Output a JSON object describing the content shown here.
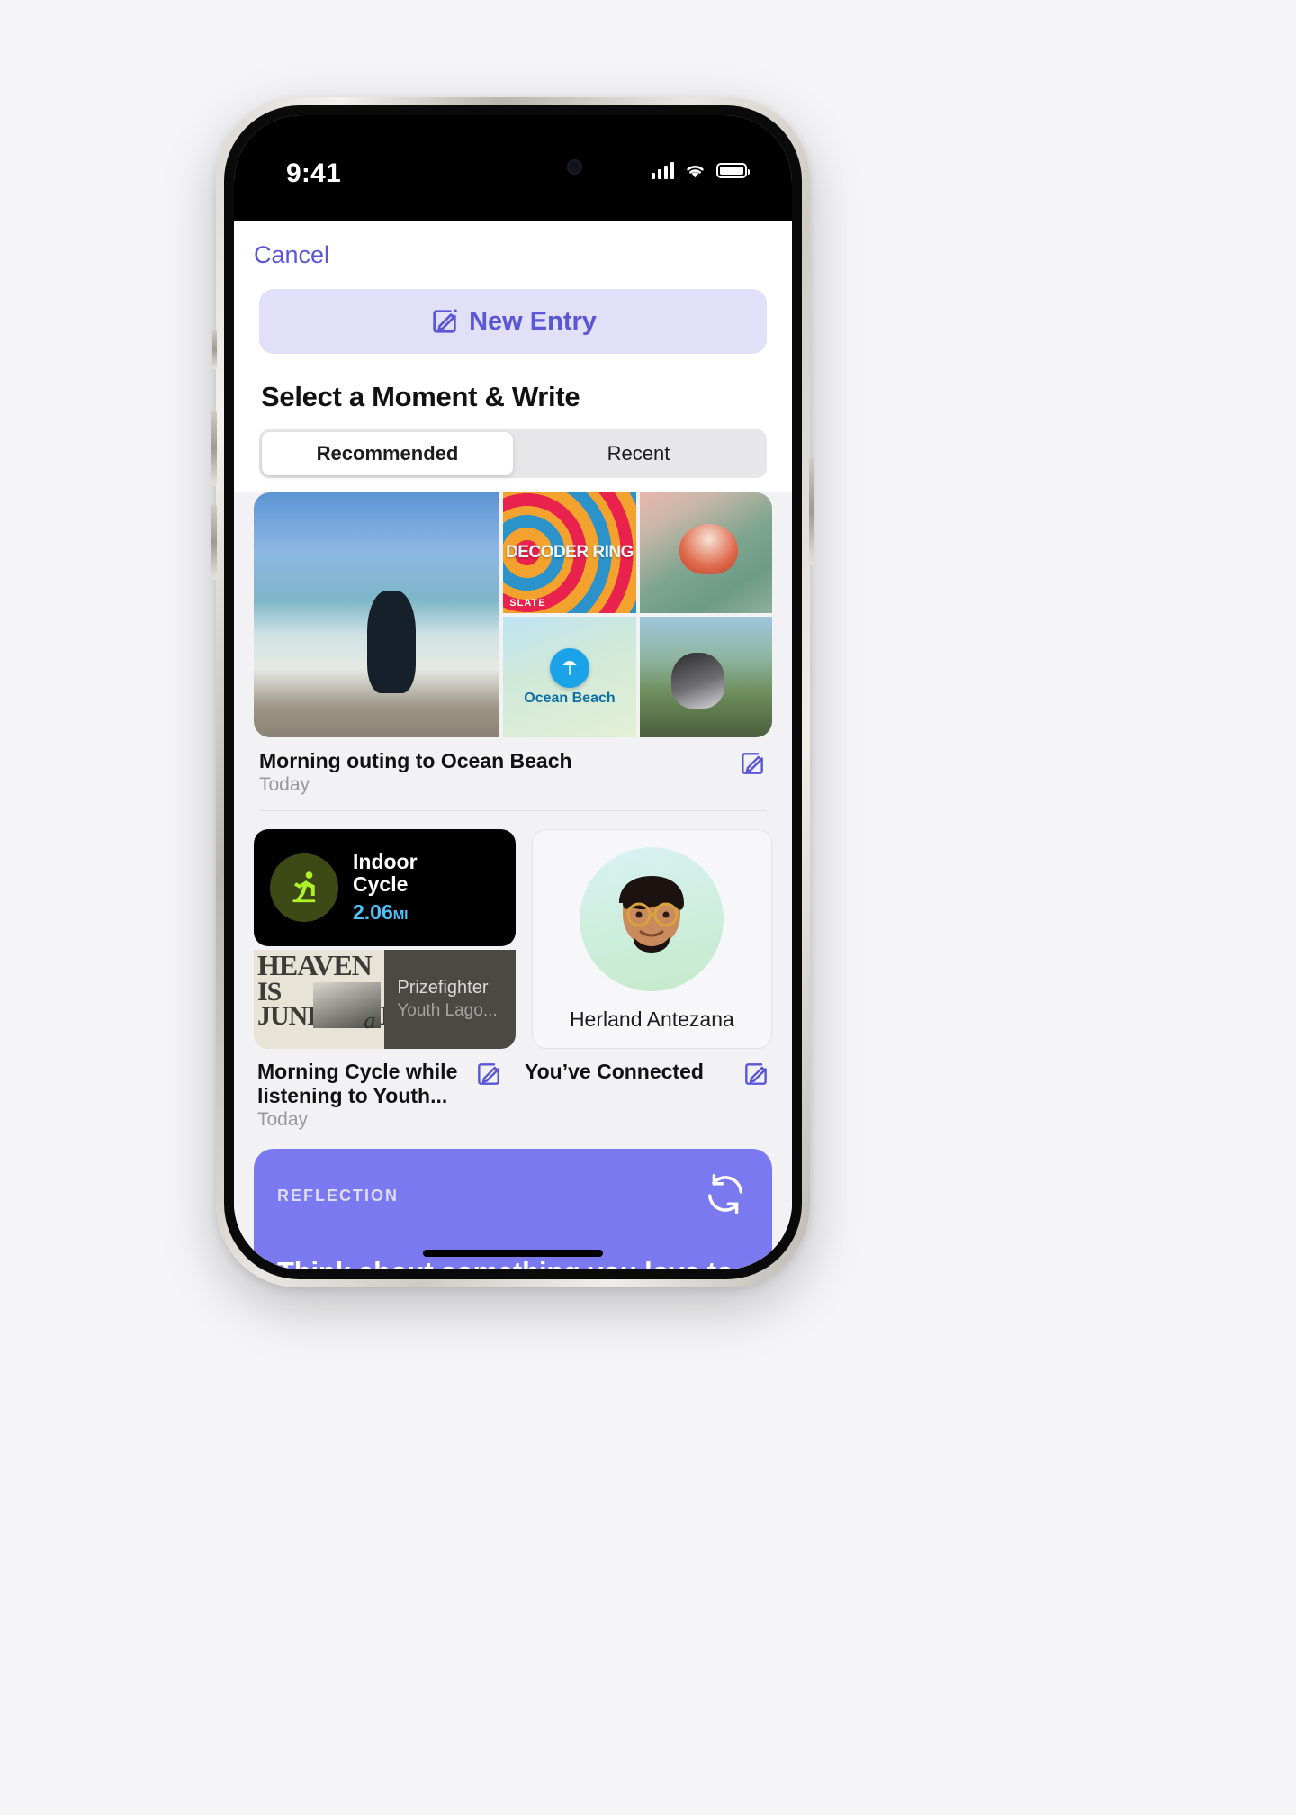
{
  "status_bar": {
    "time": "9:41",
    "signal_icon": "cellular-bars-icon",
    "wifi_icon": "wifi-icon",
    "battery_icon": "battery-icon"
  },
  "nav": {
    "cancel_label": "Cancel"
  },
  "new_entry": {
    "label": "New Entry",
    "icon": "compose-icon",
    "accent_color": "#5a56d6",
    "background_color": "#e2e0f9"
  },
  "section": {
    "title": "Select a Moment & Write"
  },
  "segmented_control": {
    "options": [
      "Recommended",
      "Recent"
    ],
    "selected": "Recommended"
  },
  "moments": [
    {
      "id": "morning-outing",
      "title": "Morning outing to Ocean Beach",
      "date": "Today",
      "edit_icon": "compose-icon",
      "tiles": [
        {
          "name": "beach-surfer-photo",
          "type": "photo"
        },
        {
          "name": "podcast-artwork",
          "type": "podcast",
          "title": "DECODER RING",
          "brand": "SLATE"
        },
        {
          "name": "seashell-photo",
          "type": "photo"
        },
        {
          "name": "map-thumbnail",
          "type": "map",
          "place": "Ocean Beach",
          "pin_icon": "beach-umbrella-icon"
        },
        {
          "name": "dog-in-car-photo",
          "type": "photo"
        }
      ]
    },
    {
      "id": "morning-cycle",
      "title": "Morning Cycle while listening to Youth...",
      "date": "Today",
      "edit_icon": "compose-icon",
      "workout": {
        "name_line1": "Indoor",
        "name_line2": "Cycle",
        "distance_value": "2.06",
        "distance_unit": "MI",
        "icon": "indoor-cycle-icon",
        "accent_color": "#4fc3f7",
        "ring_color": "#3d4a16",
        "glyph_color": "#b0f228"
      },
      "media": {
        "album_line1": "HEAVEN",
        "album_line2": "IS",
        "album_line3": "JUNKYARD",
        "album_accent": "a",
        "track_title": "Prizefighter",
        "track_artist": "Youth Lago..."
      }
    },
    {
      "id": "youve-connected",
      "title": "You’ve Connected",
      "edit_icon": "compose-icon",
      "contact": {
        "name": "Herland Antezana",
        "avatar": "memoji-avatar"
      }
    }
  ],
  "reflection": {
    "label": "REFLECTION",
    "text": "Think about something you love to do and why it brings",
    "refresh_icon": "refresh-icon",
    "background_color": "#7b79ef"
  }
}
